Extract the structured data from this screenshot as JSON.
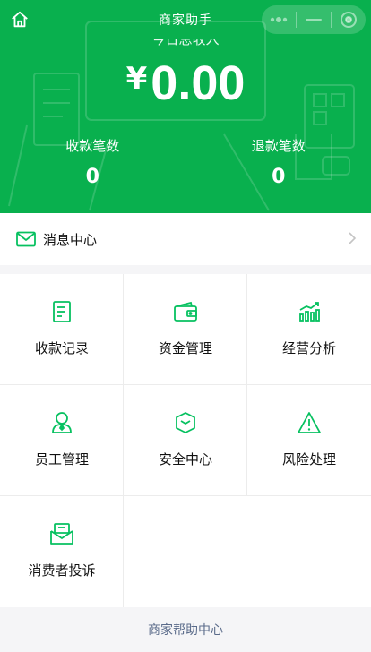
{
  "header": {
    "title": "商家助手",
    "today_label": "今日总收入",
    "currency": "¥",
    "amount": "0.00",
    "stats": [
      {
        "label": "收款笔数",
        "value": "0"
      },
      {
        "label": "退款笔数",
        "value": "0"
      }
    ],
    "capsule": [
      "more-dots-icon",
      "minimize-icon",
      "close-target-icon"
    ]
  },
  "message_center": {
    "label": "消息中心",
    "icon": "mail-icon"
  },
  "grid": [
    {
      "label": "收款记录",
      "icon": "receipt-icon"
    },
    {
      "label": "资金管理",
      "icon": "wallet-icon"
    },
    {
      "label": "经营分析",
      "icon": "bar-chart-icon"
    },
    {
      "label": "员工管理",
      "icon": "user-icon"
    },
    {
      "label": "安全中心",
      "icon": "shield-icon"
    },
    {
      "label": "风险处理",
      "icon": "warning-icon"
    },
    {
      "label": "消费者投诉",
      "icon": "complaint-mail-icon"
    }
  ],
  "footer": {
    "link": "商家帮助中心"
  },
  "colors": {
    "brand_green": "#09b04e",
    "icon_green": "#07c160",
    "link_blue": "#5a6b8a"
  }
}
